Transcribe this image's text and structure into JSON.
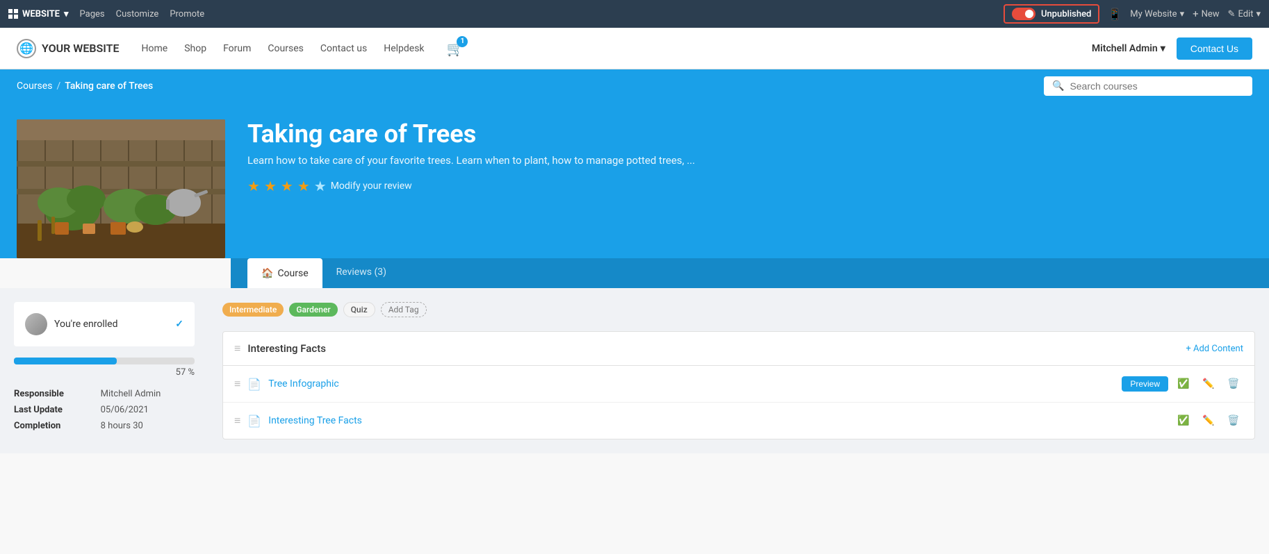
{
  "adminBar": {
    "websiteLabel": "WEBSITE",
    "navItems": [
      "Pages",
      "Customize",
      "Promote"
    ],
    "unpublishedLabel": "Unpublished",
    "mobileIcon": "📱",
    "myWebsiteLabel": "My Website",
    "newLabel": "+ New",
    "editLabel": "✎ Edit"
  },
  "siteNav": {
    "logoText": "YOUR WEBSITE",
    "links": [
      "Home",
      "Shop",
      "Forum",
      "Courses",
      "Contact us",
      "Helpdesk"
    ],
    "cartCount": "1",
    "userLabel": "Mitchell Admin",
    "contactUsLabel": "Contact Us"
  },
  "breadcrumb": {
    "coursesLabel": "Courses",
    "separator": "/",
    "currentLabel": "Taking care of Trees",
    "searchPlaceholder": "Search courses"
  },
  "hero": {
    "title": "Taking care of Trees",
    "description": "Learn how to take care of your favorite trees. Learn when to plant, how to manage potted trees, ...",
    "stars": 3.5,
    "modifyReviewLabel": "Modify your review"
  },
  "tabs": [
    {
      "label": "Course",
      "icon": "🏠",
      "active": true
    },
    {
      "label": "Reviews (3)",
      "active": false
    }
  ],
  "sidebar": {
    "enrolledText": "You're enrolled",
    "progressPercent": 57,
    "progressLabel": "57 %",
    "responsible": {
      "label": "Responsible",
      "value": "Mitchell Admin"
    },
    "lastUpdate": {
      "label": "Last Update",
      "value": "05/06/2021"
    },
    "completion": {
      "label": "Completion",
      "value": "8 hours 30"
    }
  },
  "courseContent": {
    "tags": [
      {
        "label": "Intermediate",
        "style": "yellow"
      },
      {
        "label": "Gardener",
        "style": "green"
      },
      {
        "label": "Quiz",
        "style": "light"
      }
    ],
    "addTagLabel": "Add Tag",
    "sections": [
      {
        "title": "Interesting Facts",
        "addContentLabel": "+ Add Content",
        "items": [
          {
            "name": "Tree Infographic",
            "hasPreview": true,
            "previewLabel": "Preview"
          },
          {
            "name": "Interesting Tree Facts",
            "hasPreview": false
          }
        ]
      }
    ]
  }
}
